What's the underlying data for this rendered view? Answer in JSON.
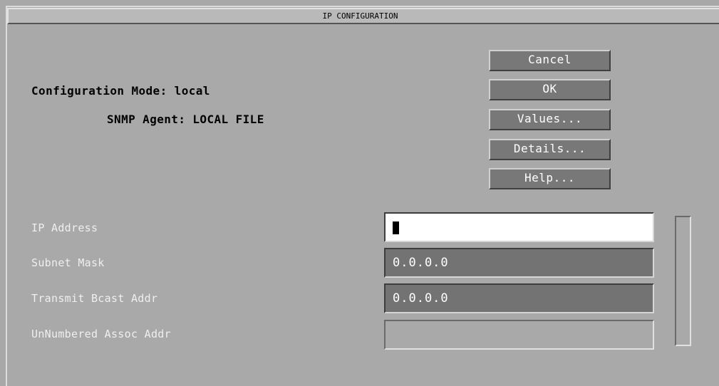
{
  "window": {
    "title": "IP CONFIGURATION"
  },
  "info": {
    "configuration_mode": "Configuration Mode: local",
    "snmp_agent": "SNMP Agent: LOCAL FILE"
  },
  "buttons": {
    "cancel": "Cancel",
    "ok": "OK",
    "values": "Values...",
    "details": "Details...",
    "help": "Help..."
  },
  "fields": [
    {
      "label": "IP Address",
      "value": ""
    },
    {
      "label": "Subnet Mask",
      "value": "0.0.0.0"
    },
    {
      "label": "Transmit Bcast Addr",
      "value": "0.0.0.0"
    },
    {
      "label": "UnNumbered Assoc Addr",
      "value": ""
    }
  ],
  "colors": {
    "background": "#a9a9a9",
    "button_face": "#787878",
    "field_dark": "#737373",
    "field_active": "#ffffff"
  }
}
